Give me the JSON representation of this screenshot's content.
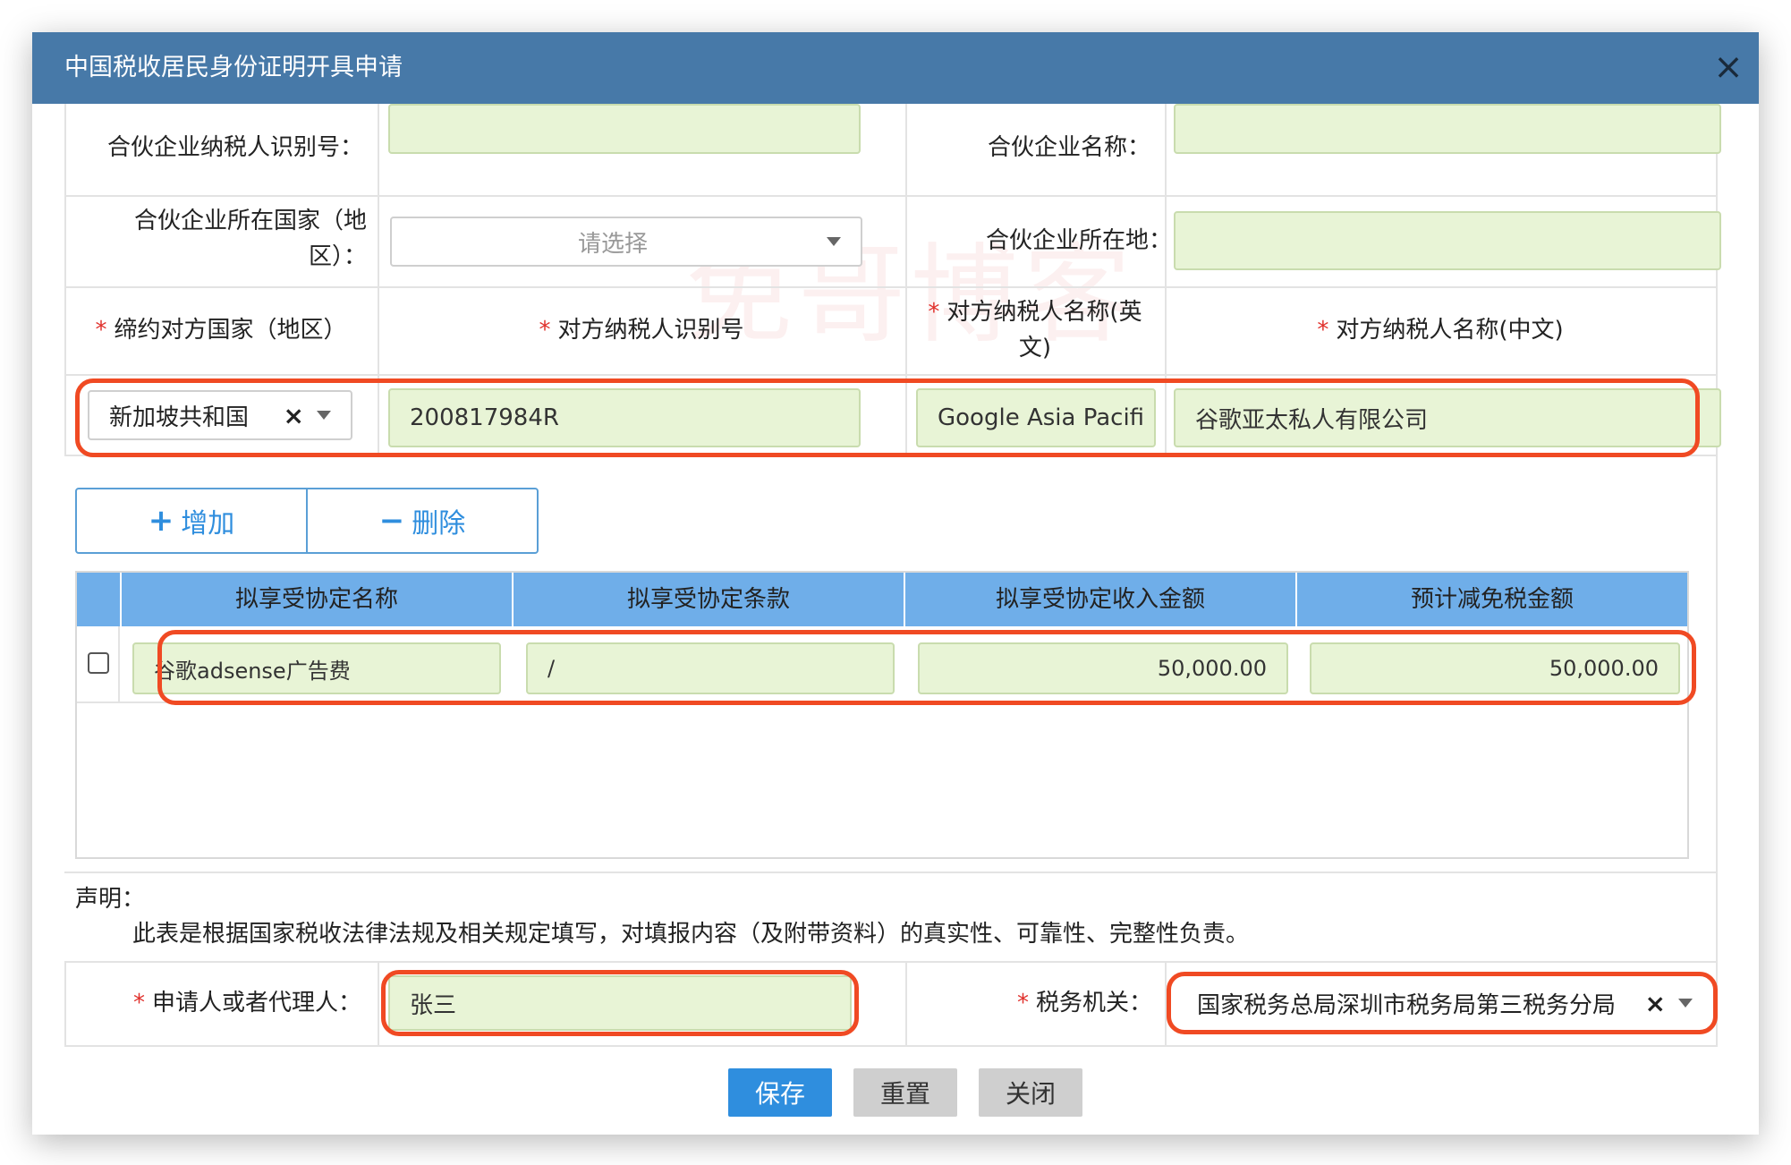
{
  "dialog": {
    "title": "中国税收居民身份证明开具申请",
    "close_glyph": "×"
  },
  "partner": {
    "tin_label": "合伙企业纳税人识别号：",
    "name_label": "合伙企业名称：",
    "country_label_1": "合伙企业所在国家（地",
    "country_label_2": "区）：",
    "country_placeholder": "请选择",
    "location_label": "合伙企业所在地："
  },
  "counterparty": {
    "required_mark": "*",
    "col_country": "缔约对方国家（地区）",
    "col_tin": "对方纳税人识别号",
    "col_name_en_1": "对方纳税人名称(英",
    "col_name_en_2": "文)",
    "col_name_cn": "对方纳税人名称(中文)",
    "country_value": "新加坡共和国",
    "tin_value": "200817984R",
    "name_en_value": "Google Asia Pacifi",
    "name_cn_value": "谷歌亚太私人有限公司"
  },
  "actions": {
    "add_label": "增加",
    "add_glyph": "+",
    "delete_label": "删除",
    "delete_glyph": "−"
  },
  "treaty_table": {
    "columns": [
      "拟享受协定名称",
      "拟享受协定条款",
      "拟享受协定收入金额",
      "预计减免税金额"
    ],
    "rows": [
      {
        "name": "谷歌adsense广告费",
        "clause": "/",
        "income": "50,000.00",
        "reduction": "50,000.00"
      }
    ]
  },
  "declaration": {
    "title": "声明：",
    "text": "此表是根据国家税收法律法规及相关规定填写，对填报内容（及附带资料）的真实性、可靠性、完整性负责。"
  },
  "applicant": {
    "label": "申请人或者代理人：",
    "value": "张三",
    "tax_office_label": "税务机关：",
    "tax_office_value": "国家税务总局深圳市税务局第三税务分局"
  },
  "footer": {
    "save_label": "保存",
    "reset_label": "重置",
    "close_label": "关闭"
  },
  "watermark": "免哥博客",
  "colors": {
    "titlebar": "#4779a8",
    "highlight": "#f04a23",
    "field_fill": "#e8f4d6",
    "grid_header": "#6faee9",
    "primary": "#2f8ede"
  }
}
